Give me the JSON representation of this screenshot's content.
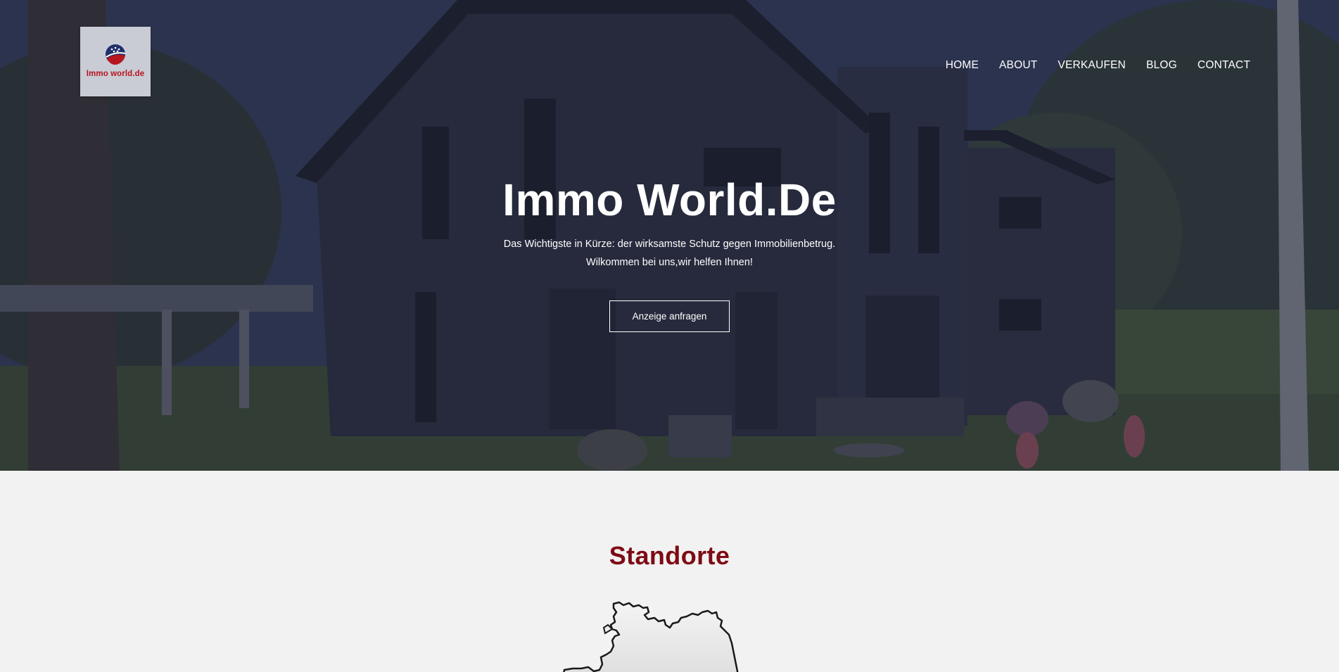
{
  "brand": {
    "logo_text": "Immo world.de",
    "colors": {
      "brand_red": "#b7151f",
      "section_title": "#7e0b14",
      "page_bg": "#f2f2f2"
    }
  },
  "nav": {
    "items": [
      {
        "label": "HOME"
      },
      {
        "label": "ABOUT"
      },
      {
        "label": "VERKAUFEN"
      },
      {
        "label": "BLOG"
      },
      {
        "label": "CONTACT"
      }
    ]
  },
  "hero": {
    "title": "Immo World.De",
    "subtitle_line1": "Das Wichtigste in Kürze: der wirksamste Schutz gegen Immobilienbetrug.",
    "subtitle_line2": "Wilkommen bei uns,wir helfen Ihnen!",
    "cta_label": "Anzeige anfragen"
  },
  "locations": {
    "title": "Standorte",
    "map_icon": "germany-map-outline"
  }
}
